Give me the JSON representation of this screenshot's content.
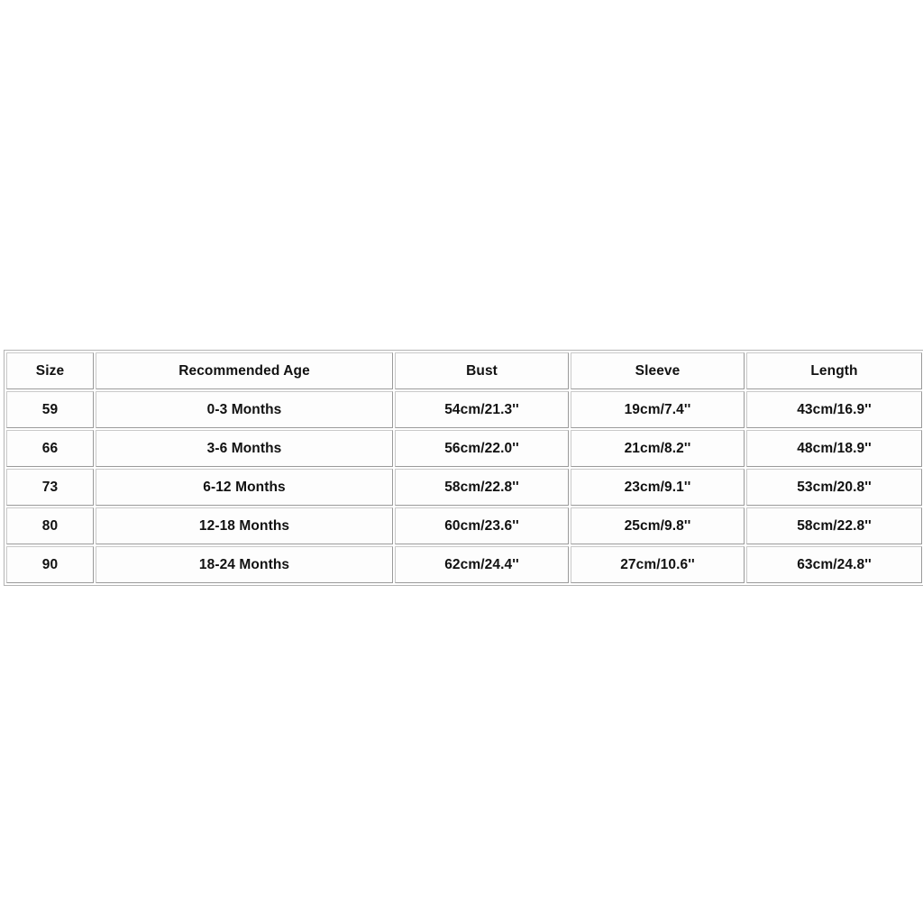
{
  "table": {
    "caption": "",
    "columns": [
      {
        "key": "size",
        "label": "Size"
      },
      {
        "key": "age",
        "label": "Recommended Age"
      },
      {
        "key": "bust",
        "label": "Bust"
      },
      {
        "key": "sleeve",
        "label": "Sleeve"
      },
      {
        "key": "length",
        "label": "Length"
      }
    ],
    "rows": [
      {
        "size": "59",
        "age": "0-3 Months",
        "bust": "54cm/21.3''",
        "sleeve": "19cm/7.4''",
        "length": "43cm/16.9''"
      },
      {
        "size": "66",
        "age": "3-6 Months",
        "bust": "56cm/22.0''",
        "sleeve": "21cm/8.2''",
        "length": "48cm/18.9''"
      },
      {
        "size": "73",
        "age": "6-12 Months",
        "bust": "58cm/22.8''",
        "sleeve": "23cm/9.1''",
        "length": "53cm/20.8''"
      },
      {
        "size": "80",
        "age": "12-18 Months",
        "bust": "60cm/23.6''",
        "sleeve": "25cm/9.8''",
        "length": "58cm/22.8''"
      },
      {
        "size": "90",
        "age": "18-24 Months",
        "bust": "62cm/24.4''",
        "sleeve": "27cm/10.6''",
        "length": "63cm/24.8''"
      }
    ]
  },
  "colors": {
    "page_background": "#ffffff",
    "cell_background": "#fdfdfd",
    "border_light": "#c9c9c9",
    "border_dark": "#9a9a9a",
    "text": "#111111"
  }
}
